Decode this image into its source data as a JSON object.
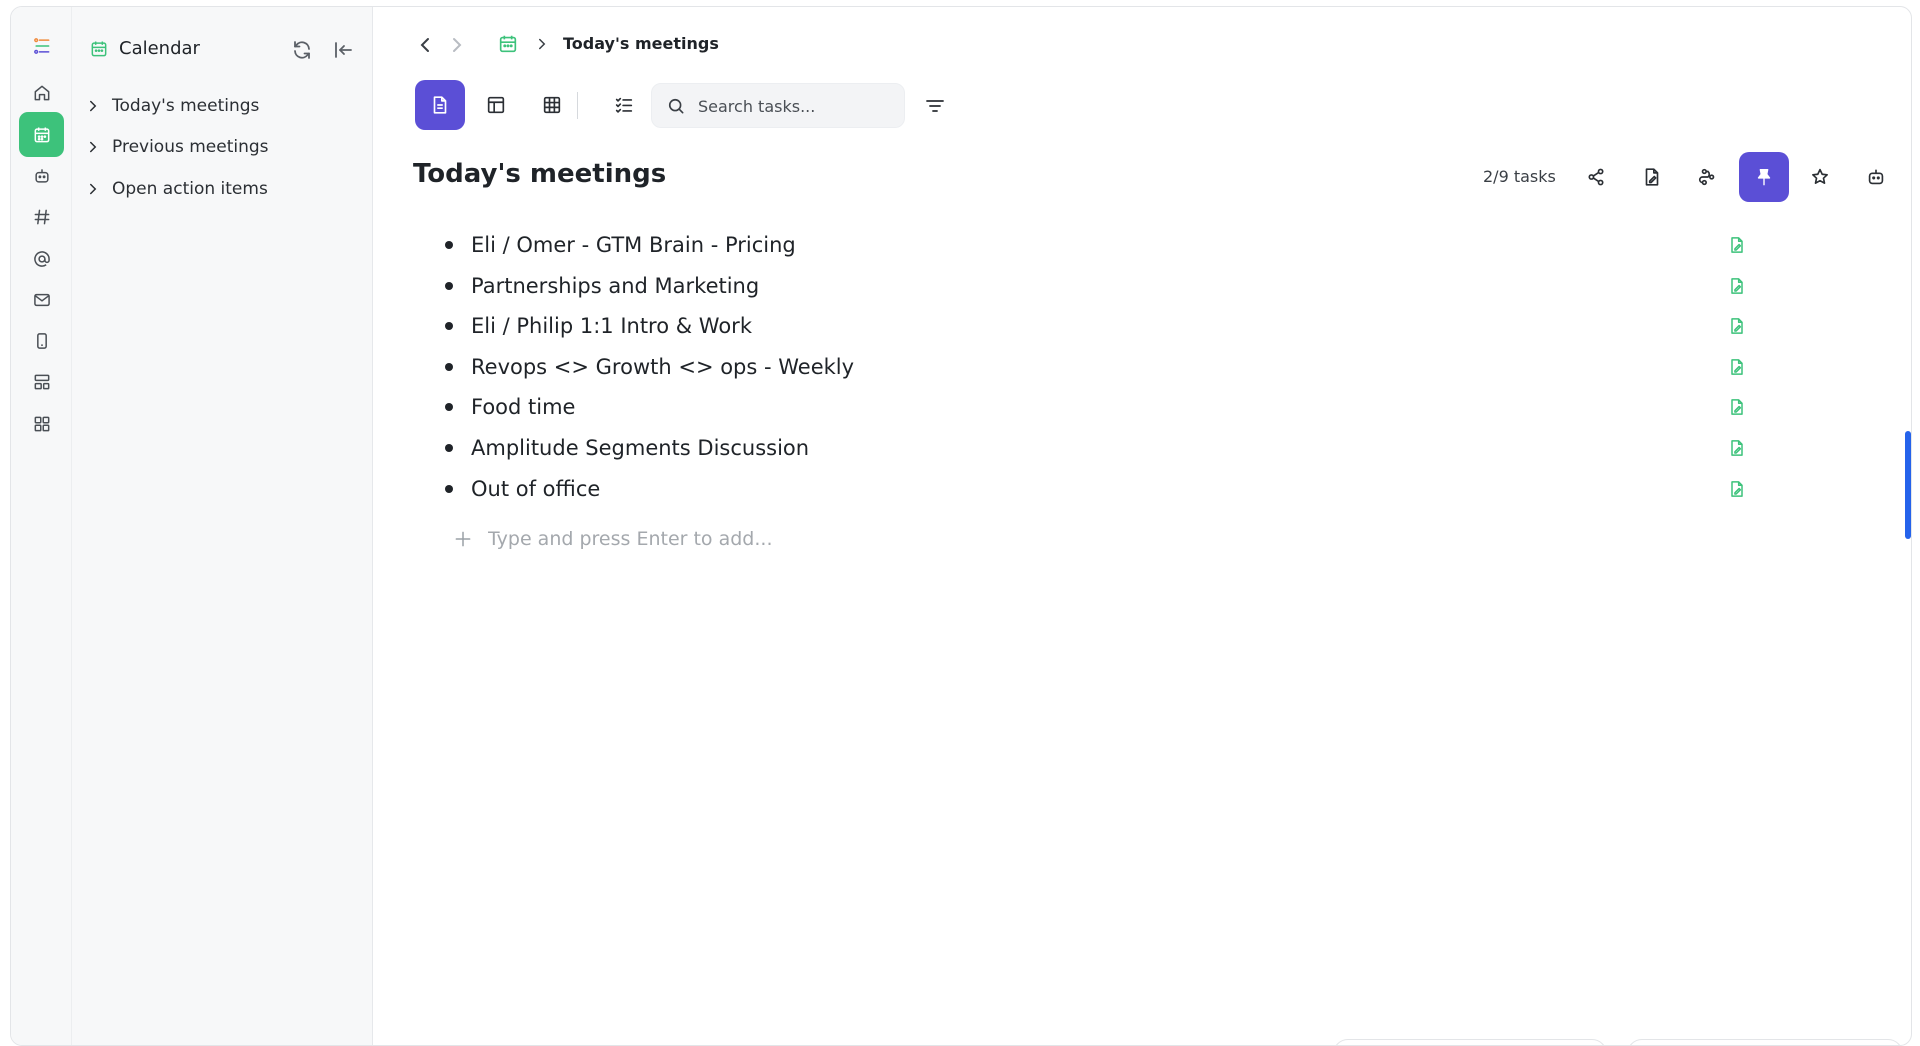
{
  "sidebar": {
    "title": "Calendar",
    "items": [
      {
        "label": "Today's meetings"
      },
      {
        "label": "Previous meetings"
      },
      {
        "label": "Open action items"
      }
    ]
  },
  "rail": {
    "items": [
      "logo-icon",
      "home-icon",
      "calendar-icon",
      "bot-icon",
      "hash-icon",
      "at-icon",
      "mail-icon",
      "phone-icon",
      "layout-icon",
      "apps-icon"
    ],
    "active": "calendar-icon"
  },
  "breadcrumb": {
    "title": "Today's meetings"
  },
  "toolbar": {
    "search_placeholder": "Search tasks...",
    "views": [
      "document-view",
      "board-view",
      "table-view",
      "checklist-view"
    ],
    "active_view": "document-view"
  },
  "page": {
    "title": "Today's meetings",
    "task_count": "2/9 tasks",
    "add_placeholder": "Type and press Enter to add..."
  },
  "tasks": [
    {
      "label": "Eli / Omer - GTM Brain - Pricing"
    },
    {
      "label": "Partnerships and Marketing"
    },
    {
      "label": "Eli / Philip 1:1 Intro & Work"
    },
    {
      "label": "Revops <> Growth <> ops - Weekly"
    },
    {
      "label": "Food time"
    },
    {
      "label": "Amplitude Segments Discussion"
    },
    {
      "label": "Out of office"
    }
  ],
  "colors": {
    "accent": "#5b4fd6",
    "calendar_green": "#3dc27b",
    "scroll_blue": "#2563eb"
  }
}
